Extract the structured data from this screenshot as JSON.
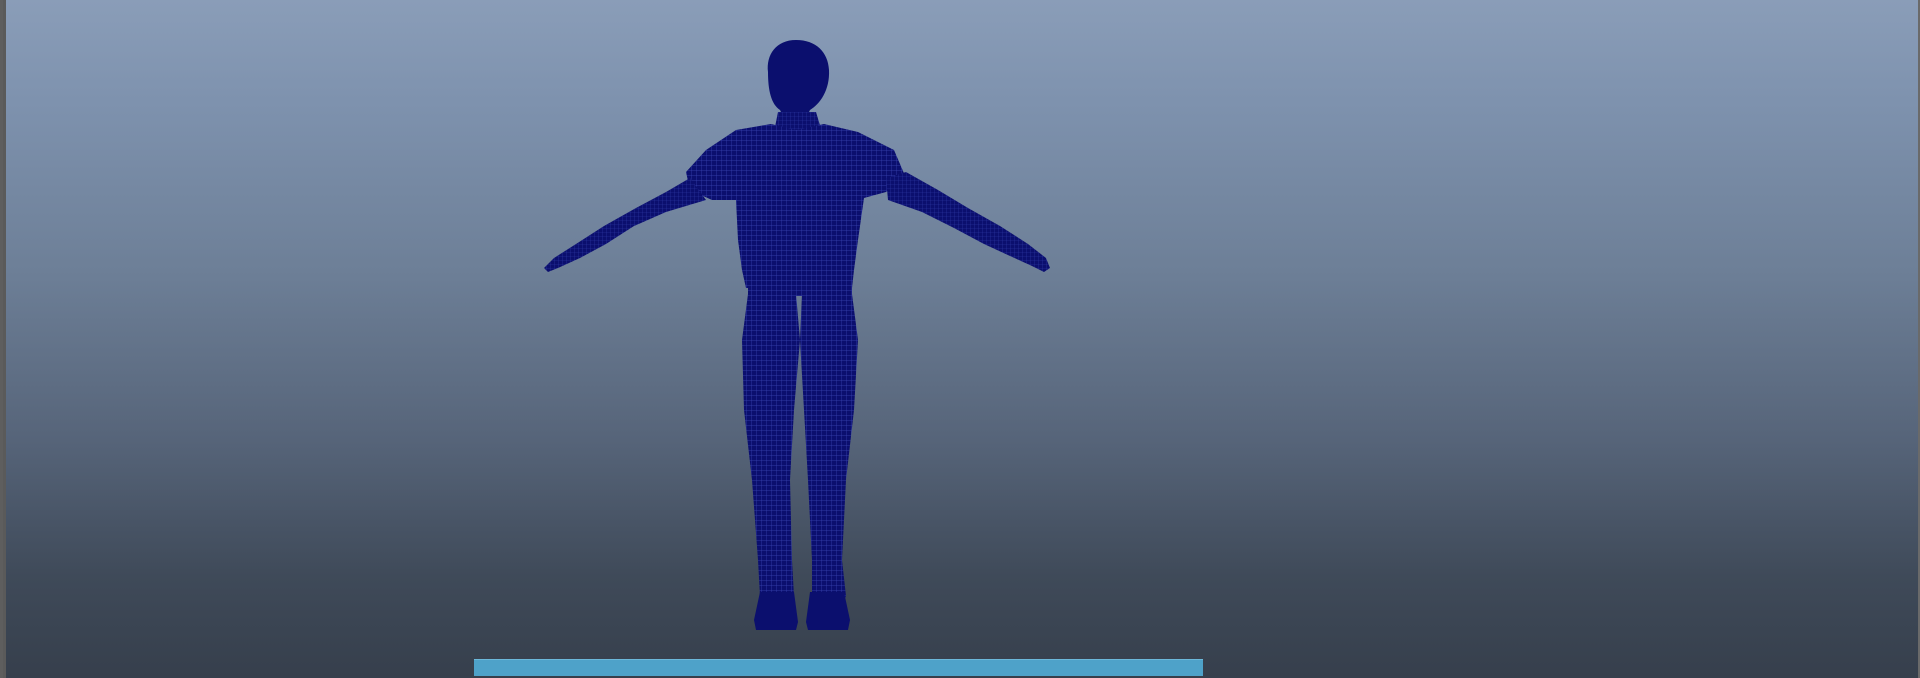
{
  "viewport": {
    "background_top": "#8a9db8",
    "background_bottom": "#363f4c",
    "mesh_color": "#0b0f6e",
    "wire_color": "#3a45b5",
    "display_mode": "wireframe"
  },
  "character": {
    "pose": "T-pose",
    "icon": "human-figure-icon"
  },
  "timeline": {
    "color": "#4ea2c9",
    "progress": 1.0
  }
}
